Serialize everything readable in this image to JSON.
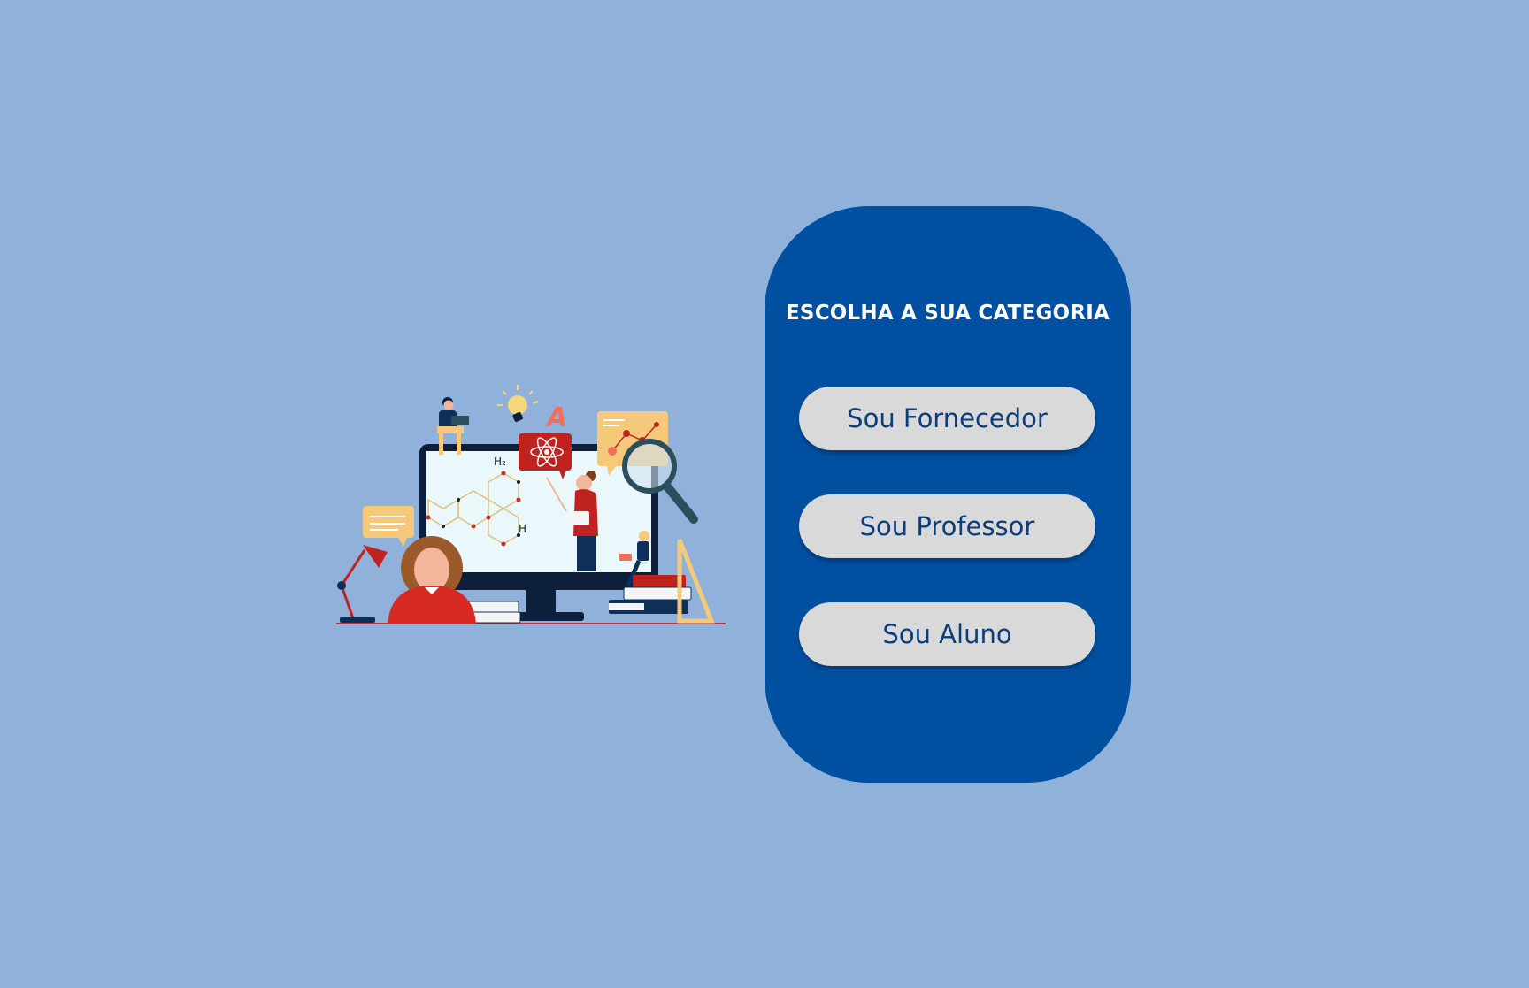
{
  "panel": {
    "title": "ESCOLHA A SUA CATEGORIA",
    "buttons": [
      {
        "label": "Sou Fornecedor"
      },
      {
        "label": "Sou Professor"
      },
      {
        "label": "Sou Aluno"
      }
    ]
  },
  "illustration": {
    "chem_labels": {
      "h2": "H₂",
      "h": "H"
    },
    "letter": "A"
  },
  "colors": {
    "background": "#90b2da",
    "panel": "#0050a2",
    "button": "#d9d9d9",
    "button_text": "#0a3d7a",
    "title_text": "#ffffff"
  }
}
